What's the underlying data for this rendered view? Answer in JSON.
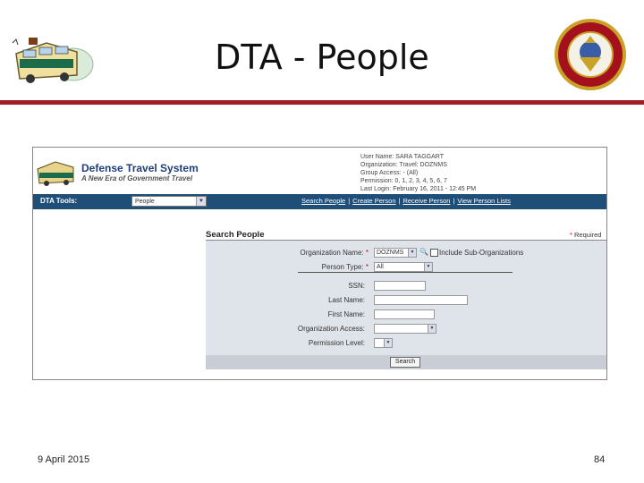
{
  "slide": {
    "title": "DTA - People",
    "date": "9 April 2015",
    "page_number": "84",
    "accent_color": "#a01f24"
  },
  "dts": {
    "title": "Defense Travel System",
    "subtitle": "A New Era of Government Travel",
    "user_info": [
      "User Name: SARA TAGGART",
      "Organization: Travel: DOZNMS",
      "Group Access: - (All)",
      "Permission: 0, 1, 2, 3, 4, 5, 6, 7",
      "Last Login: February 16, 2011 - 12:45 PM"
    ],
    "nav": {
      "tools_label": "DTA Tools:",
      "tools_selected": "People",
      "links": [
        "Search People",
        "Create Person",
        "Receive Person",
        "View Person Lists"
      ]
    },
    "search": {
      "title": "Search People",
      "required_note": "Required",
      "org_name_label": "Organization Name:",
      "org_name_value": "DOZNMS",
      "include_sub_label": "Include Sub-Organizations",
      "person_type_label": "Person Type:",
      "person_type_value": "All",
      "ssn_label": "SSN:",
      "last_name_label": "Last Name:",
      "first_name_label": "First Name:",
      "org_access_label": "Organization Access:",
      "permission_label": "Permission Level:",
      "search_button": "Search"
    }
  }
}
